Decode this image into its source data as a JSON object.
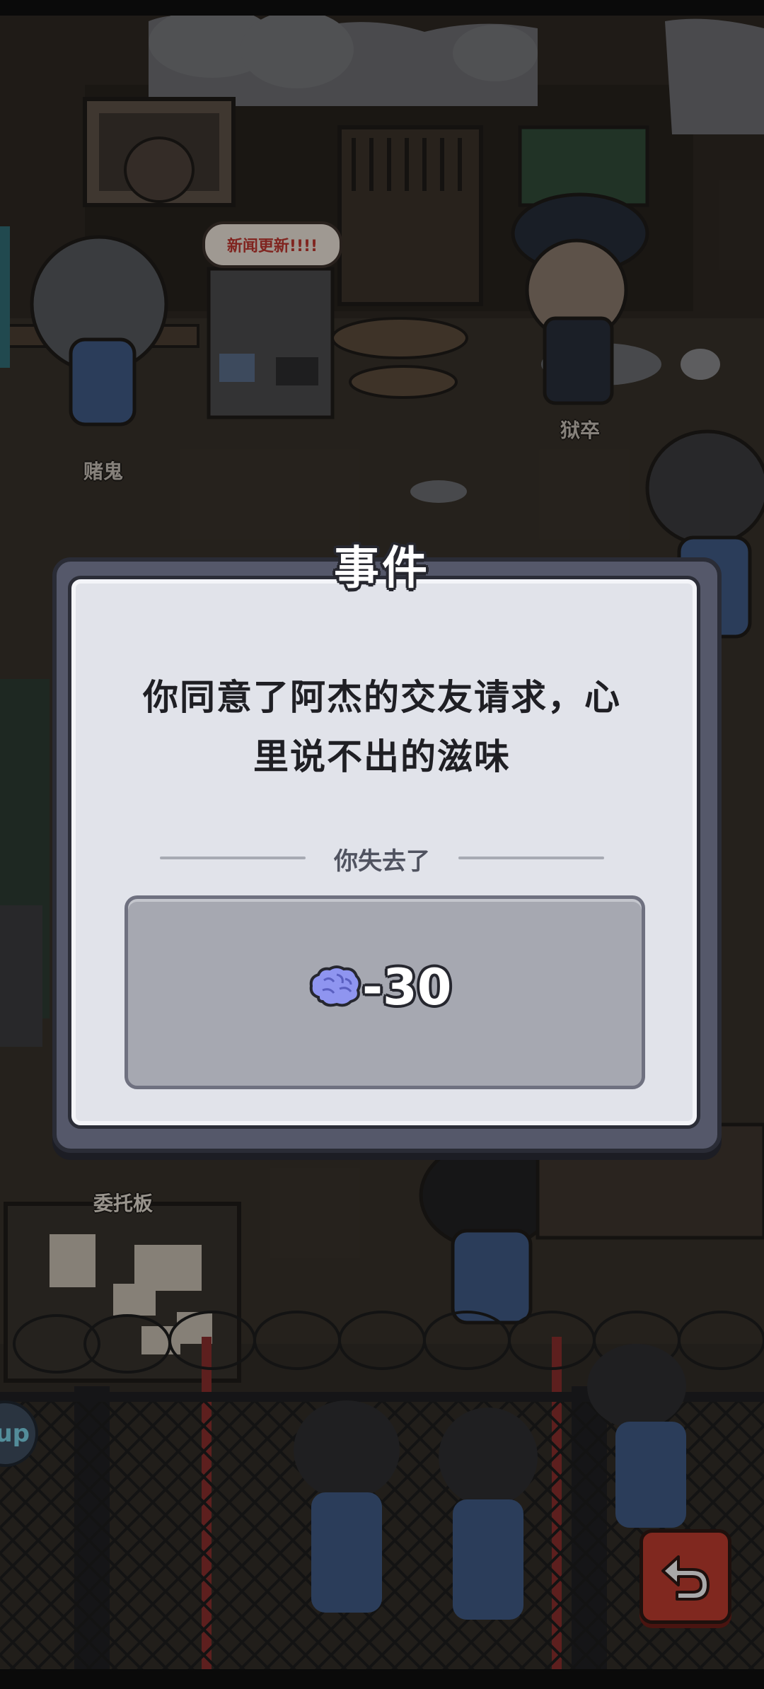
{
  "scene": {
    "news_bubble": "新闻更新!!!!",
    "npc_gambler": "赌鬼",
    "npc_guard": "狱卒",
    "board_title": "委托板",
    "side_button_text": "up"
  },
  "event_dialog": {
    "title": "事件",
    "message_line1": "你同意了阿杰的交友请求，心",
    "message_line2": "里说不出的滋味",
    "lost_label": "你失去了",
    "reward_icon": "brain-icon",
    "reward_value": "-30"
  },
  "controls": {
    "back_icon": "return-arrow-icon"
  },
  "colors": {
    "dialog_frame": "#55586a",
    "dialog_panel": "#e1e3ea",
    "reward_box": "#a6a8b1",
    "brain": "#8f95f0",
    "back_button": "#c13a2c"
  }
}
